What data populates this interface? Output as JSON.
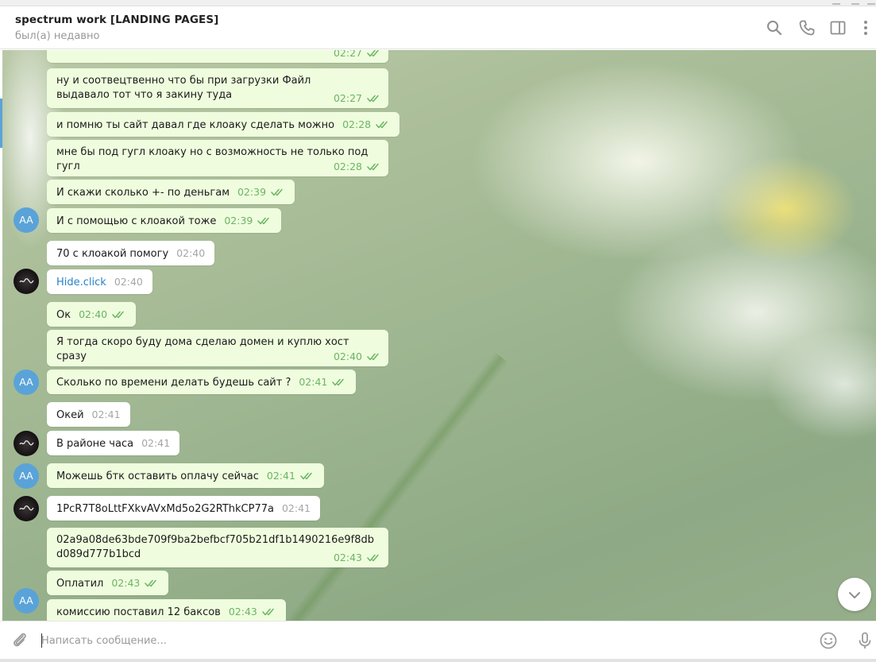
{
  "header": {
    "title": "spectrum work [LANDING PAGES]",
    "status": "был(а) недавно",
    "icons": [
      "search-icon",
      "phone-icon",
      "sidebar-toggle-icon",
      "more-vertical-icon"
    ]
  },
  "colors": {
    "outgoing_bubble": "#effdde",
    "incoming_bubble": "#ffffff",
    "time_outgoing": "#6cb465",
    "time_incoming": "#a6a6a6",
    "avatar_aa": "#5aa3d8",
    "link": "#2a82c9"
  },
  "avatars": {
    "me_initials": "AA"
  },
  "messages": [
    {
      "dir": "out",
      "text": "",
      "time": "02:27"
    },
    {
      "dir": "out",
      "text": "ну и соотвецтвенно что бы при загрузки Файл выдавало тот что я закину туда",
      "time": "02:27"
    },
    {
      "dir": "out",
      "text": "и помню ты сайт давал где клоаку сделать можно",
      "time": "02:28"
    },
    {
      "dir": "out",
      "text": "мне бы под гугл клоаку но с возможность не только под гугл",
      "time": "02:28"
    },
    {
      "dir": "out",
      "text": "И скажи сколько +- по деньгам",
      "time": "02:39"
    },
    {
      "dir": "out",
      "text": "И с помощью с клоакой тоже",
      "time": "02:39"
    },
    {
      "dir": "in",
      "text": "70 с клоакой помогу",
      "time": "02:40"
    },
    {
      "dir": "in",
      "text": "Hide.click",
      "time": "02:40",
      "link": true
    },
    {
      "dir": "out",
      "text": "Ок",
      "time": "02:40"
    },
    {
      "dir": "out",
      "text": "Я тогда скоро буду дома сделаю домен и куплю хост сразу",
      "time": "02:40"
    },
    {
      "dir": "out",
      "text": "Сколько по времени делать будешь сайт ?",
      "time": "02:41"
    },
    {
      "dir": "in",
      "text": "Окей",
      "time": "02:41"
    },
    {
      "dir": "in",
      "text": "В районе часа",
      "time": "02:41"
    },
    {
      "dir": "out",
      "text": "Можешь бтк оставить оплачу сейчас",
      "time": "02:41"
    },
    {
      "dir": "in",
      "text": "1PcR7T8oLttFXkvAVxMd5o2G2RThkCP77a",
      "time": "02:41"
    },
    {
      "dir": "out",
      "text": "02a9a08de63bde709f9ba2befbcf705b21df1b1490216e9f8dbd089d777b1bcd",
      "time": "02:43"
    },
    {
      "dir": "out",
      "text": "Оплатил",
      "time": "02:43"
    },
    {
      "dir": "out",
      "text": "комиссию поставил 12 баксов",
      "time": "02:43"
    }
  ],
  "composer": {
    "placeholder": "Написать сообщение...",
    "icons": [
      "paperclip-icon",
      "emoji-icon",
      "microphone-icon"
    ]
  }
}
